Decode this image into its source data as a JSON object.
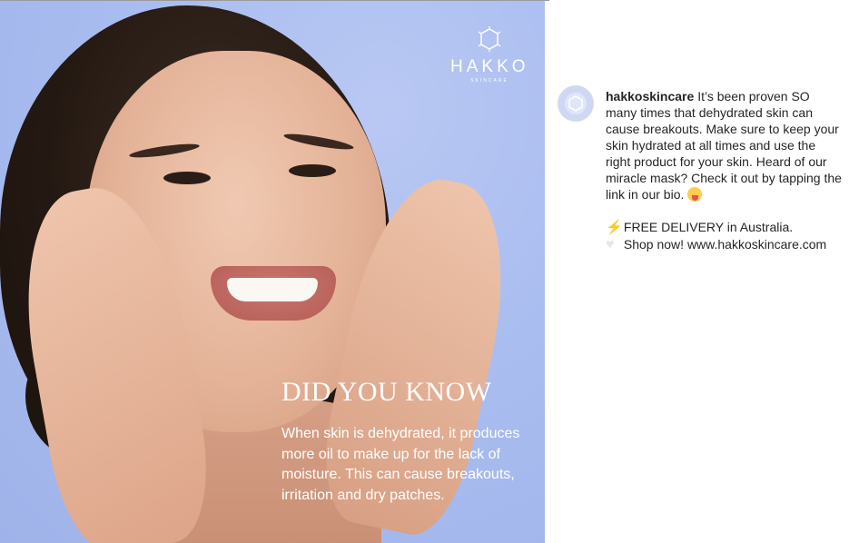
{
  "post_image": {
    "logo": {
      "name": "HAKKO",
      "sub": "SKINCARE"
    },
    "headline": "DID YOU KNOW",
    "body": "When skin is dehydrated, it produces more oil to make up for the lack of moisture. This can cause breakouts, irritation and dry patches."
  },
  "caption": {
    "username": "hakkoskincare",
    "text": "It’s been proven SO many times that dehydrated skin can cause breakouts. Make sure to keep your skin hydrated at all times and use the right product for your skin. Heard of our miracle mask? Check it out by tapping the link in our bio.",
    "emoji_1": "tongue-out-wink-emoji",
    "line_delivery": "FREE DELIVERY in Australia.",
    "line_shop": "Shop now! www.hakkoskincare.com",
    "icon_delivery": "lightning-bolt-icon",
    "icon_shop": "white-heart-icon"
  },
  "colors": {
    "image_background": "#aabdf0",
    "caption_text": "#262626"
  }
}
